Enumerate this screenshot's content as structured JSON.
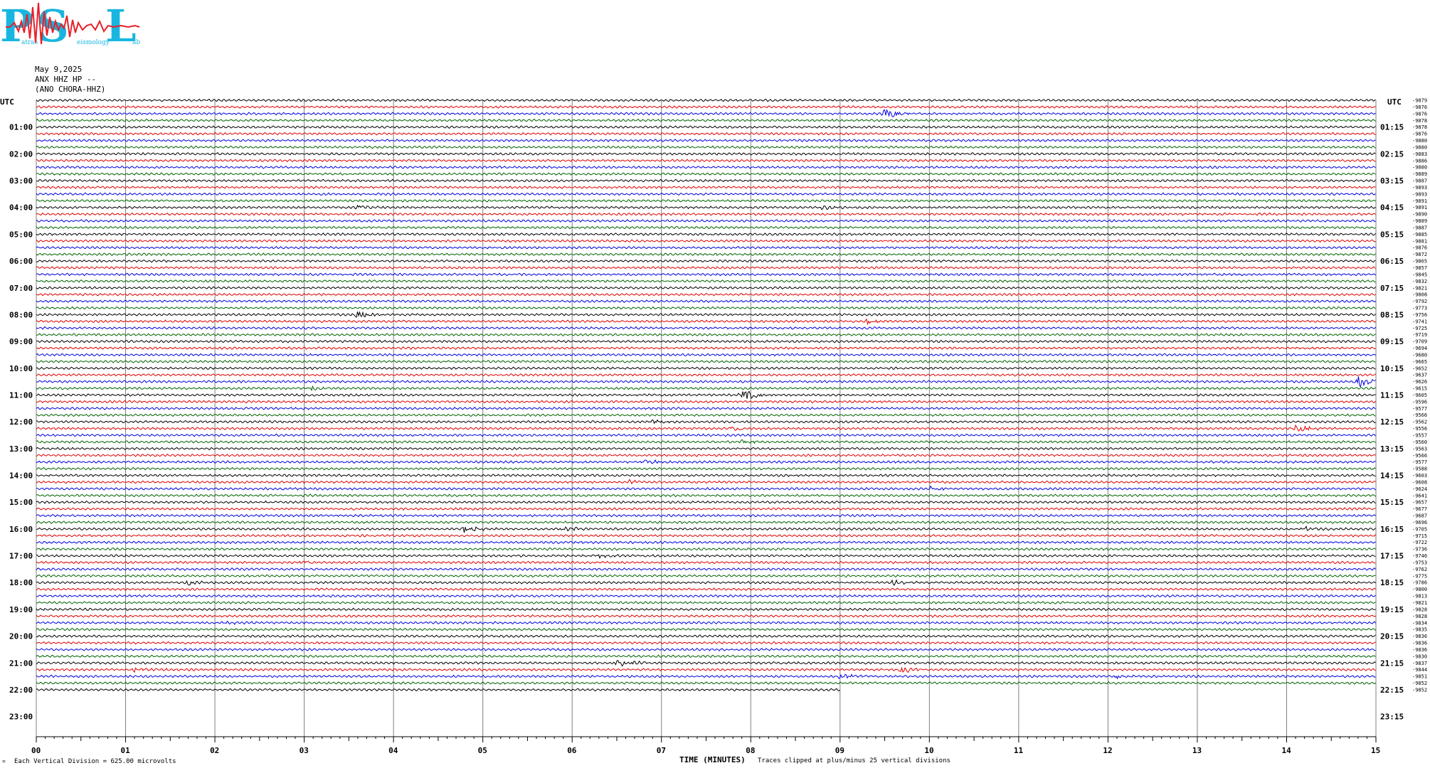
{
  "logo": {
    "letters": [
      "P",
      "S",
      "L"
    ],
    "small_words": [
      "atras",
      "eismology",
      "ab"
    ],
    "color": "#17b6e0",
    "wave_color": "#e8202a"
  },
  "header": {
    "date": "May 9,2025",
    "station": "ANX HHZ HP --",
    "location": "(ANO CHORA-HHZ)"
  },
  "axes": {
    "left_title": "UTC",
    "right_title": "UTC",
    "x_title": "TIME (MINUTES)",
    "footer_left": "Each Vertical Division =  625.00 microvolts",
    "footer_clip": "Traces clipped at plus/minus 25 vertical divisions"
  },
  "chart_data": {
    "type": "line",
    "title": "",
    "xlabel": "TIME (MINUTES)",
    "ylabel": "UTC",
    "xlim": [
      0,
      15
    ],
    "x_ticks": [
      "00",
      "01",
      "02",
      "03",
      "04",
      "05",
      "06",
      "07",
      "08",
      "09",
      "10",
      "11",
      "12",
      "13",
      "14",
      "15"
    ],
    "minute_divisions": 15,
    "lines_per_hour": 4,
    "total_rows": 96,
    "trace_count": 89,
    "last_trace_end_minute": 9,
    "trace_colors": [
      "#000000",
      "#e00000",
      "#0000e0",
      "#006400"
    ],
    "left_hour_labels": [
      "01:00",
      "02:00",
      "03:00",
      "04:00",
      "05:00",
      "06:00",
      "07:00",
      "08:00",
      "09:00",
      "10:00",
      "11:00",
      "12:00",
      "13:00",
      "14:00",
      "15:00",
      "16:00",
      "17:00",
      "18:00",
      "19:00",
      "20:00",
      "21:00",
      "22:00",
      "23:00"
    ],
    "right_hour_labels": [
      "01:15",
      "02:15",
      "03:15",
      "04:15",
      "05:15",
      "06:15",
      "07:15",
      "08:15",
      "09:15",
      "10:15",
      "11:15",
      "12:15",
      "13:15",
      "14:15",
      "15:15",
      "16:15",
      "17:15",
      "18:15",
      "19:15",
      "20:15",
      "21:15",
      "22:15",
      "23:15"
    ],
    "trace_offsets": [
      "-9879",
      "-9876",
      "-9876",
      "-9878",
      "-9878",
      "-9876",
      "-9880",
      "-9880",
      "-9883",
      "-9886",
      "-9880",
      "-9889",
      "-9887",
      "-9893",
      "-9893",
      "-9891",
      "-9891",
      "-9890",
      "-9889",
      "-9887",
      "-9885",
      "-9881",
      "-9876",
      "-9872",
      "-9865",
      "-9857",
      "-9845",
      "-9832",
      "-9821",
      "-9808",
      "-9792",
      "-9773",
      "-9756",
      "-9741",
      "-9725",
      "-9719",
      "-9709",
      "-9694",
      "-9680",
      "-9665",
      "-9652",
      "-9637",
      "-9626",
      "-9615",
      "-9605",
      "-9596",
      "-9577",
      "-9566",
      "-9562",
      "-9556",
      "-9557",
      "-9560",
      "-9563",
      "-9566",
      "-9577",
      "-9588",
      "-9603",
      "-9608",
      "-9624",
      "-9641",
      "-9657",
      "-9677",
      "-9687",
      "-9696",
      "-9705",
      "-9715",
      "-9722",
      "-9736",
      "-9746",
      "-9753",
      "-9762",
      "-9775",
      "-9786",
      "-9800",
      "-9813",
      "-9821",
      "-9828",
      "-9828",
      "-9834",
      "-9835",
      "-9836",
      "-9836",
      "-9836",
      "-9830",
      "-9837",
      "-9844",
      "-9851",
      "-9852",
      "-9852"
    ],
    "events": [
      {
        "row": 2,
        "minute": 9.5,
        "amplitude": 9,
        "color_index": 2
      },
      {
        "row": 16,
        "minute": 3.6,
        "amplitude": 3,
        "color_index": 0
      },
      {
        "row": 16,
        "minute": 8.8,
        "amplitude": 3,
        "color_index": 0
      },
      {
        "row": 32,
        "minute": 3.6,
        "amplitude": 5,
        "color_index": 0
      },
      {
        "row": 33,
        "minute": 9.3,
        "amplitude": 4,
        "color_index": 1
      },
      {
        "row": 42,
        "minute": 14.8,
        "amplitude": 10,
        "color_index": 2
      },
      {
        "row": 43,
        "minute": 3.1,
        "amplitude": 3,
        "color_index": 0
      },
      {
        "row": 44,
        "minute": 7.9,
        "amplitude": 8,
        "color_index": 3
      },
      {
        "row": 48,
        "minute": 6.9,
        "amplitude": 3,
        "color_index": 0
      },
      {
        "row": 49,
        "minute": 7.8,
        "amplitude": 4,
        "color_index": 1
      },
      {
        "row": 49,
        "minute": 14.1,
        "amplitude": 5,
        "color_index": 1
      },
      {
        "row": 51,
        "minute": 7.9,
        "amplitude": 3,
        "color_index": 3
      },
      {
        "row": 54,
        "minute": 6.8,
        "amplitude": 4,
        "color_index": 0
      },
      {
        "row": 57,
        "minute": 6.6,
        "amplitude": 3,
        "color_index": 1
      },
      {
        "row": 58,
        "minute": 10.0,
        "amplitude": 3,
        "color_index": 3
      },
      {
        "row": 64,
        "minute": 4.8,
        "amplitude": 5,
        "color_index": 0
      },
      {
        "row": 64,
        "minute": 5.9,
        "amplitude": 3,
        "color_index": 0
      },
      {
        "row": 64,
        "minute": 14.2,
        "amplitude": 3,
        "color_index": 1
      },
      {
        "row": 68,
        "minute": 6.3,
        "amplitude": 3,
        "color_index": 0
      },
      {
        "row": 69,
        "minute": 3.0,
        "amplitude": 3,
        "color_index": 1
      },
      {
        "row": 72,
        "minute": 1.7,
        "amplitude": 3,
        "color_index": 0
      },
      {
        "row": 72,
        "minute": 9.6,
        "amplitude": 3,
        "color_index": 0
      },
      {
        "row": 78,
        "minute": 2.1,
        "amplitude": 3,
        "color_index": 2
      },
      {
        "row": 84,
        "minute": 6.5,
        "amplitude": 6,
        "color_index": 0
      },
      {
        "row": 85,
        "minute": 1.1,
        "amplitude": 3,
        "color_index": 1
      },
      {
        "row": 85,
        "minute": 9.7,
        "amplitude": 5,
        "color_index": 1
      },
      {
        "row": 86,
        "minute": 9.0,
        "amplitude": 4,
        "color_index": 2
      },
      {
        "row": 86,
        "minute": 12.1,
        "amplitude": 3,
        "color_index": 2
      }
    ]
  }
}
